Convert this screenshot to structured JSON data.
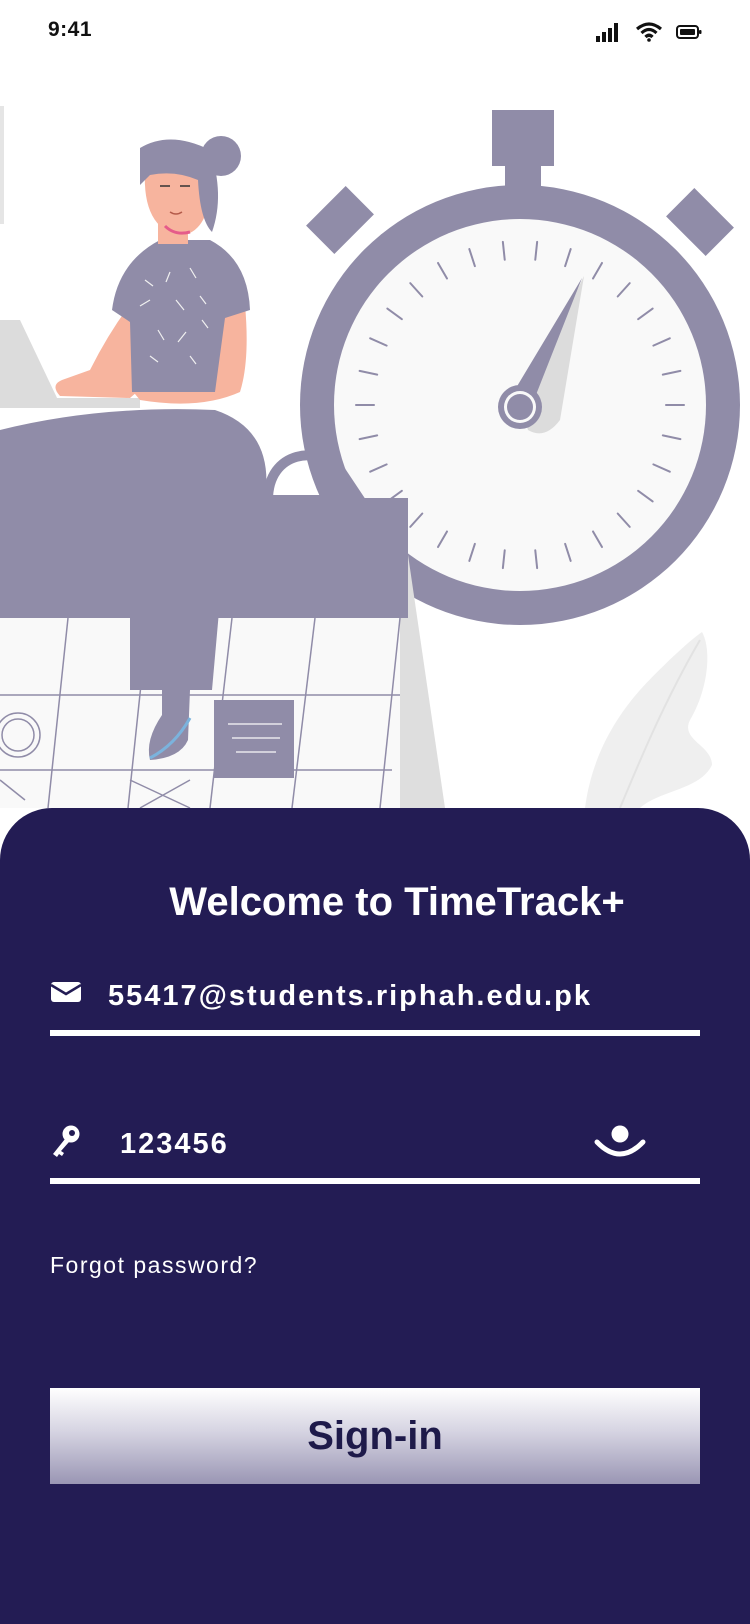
{
  "status_bar": {
    "time": "9:41",
    "icons": [
      "signal-icon",
      "wifi-icon",
      "battery-icon"
    ]
  },
  "illustration": {
    "description_icon": "woman-laptop-stopwatch-calendar-illustration"
  },
  "login": {
    "title": "Welcome to TimeTrack+",
    "email": {
      "value": "55417@students.riphah.edu.pk",
      "icon": "envelope-icon"
    },
    "password": {
      "value": "123456",
      "icon": "key-icon",
      "toggle_icon": "eye-icon"
    },
    "forgot_label": "Forgot password?",
    "signin_label": "Sign-in"
  },
  "colors": {
    "panel": "#231c54",
    "illustration": "#908ca8",
    "button_text": "#1e1a4a",
    "text": "#ffffff"
  }
}
